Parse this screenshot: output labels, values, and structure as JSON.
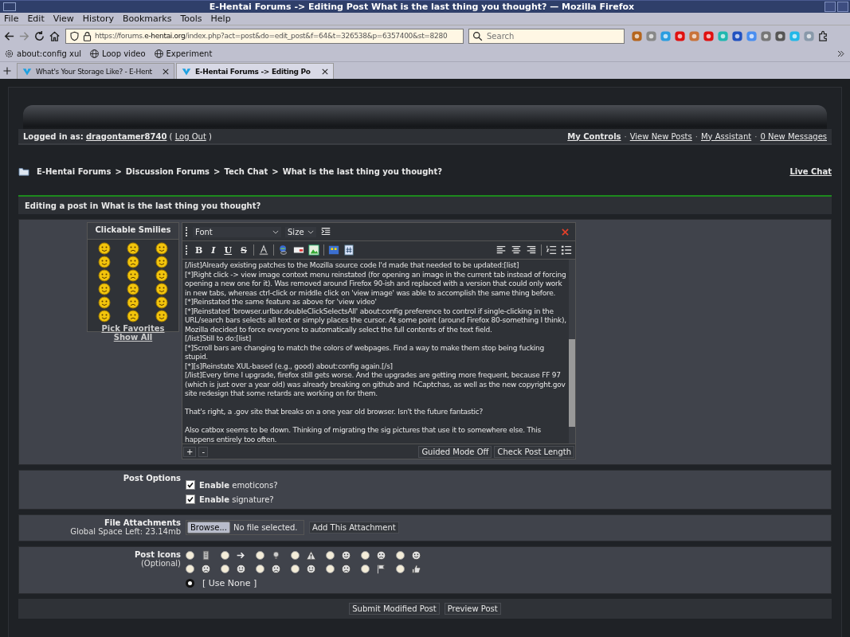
{
  "window": {
    "title": "E-Hentai Forums -> Editing Post What is the last thing you thought? — Mozilla Firefox"
  },
  "menu": [
    "File",
    "Edit",
    "View",
    "History",
    "Bookmarks",
    "Tools",
    "Help"
  ],
  "toolbar": {
    "url_prefix": "https://forums.",
    "url_host": "e-hentai.org",
    "url_path": "/index.php?act=post&do=edit_post&f=64&t=326538&p=6357400&st=8280",
    "search": {
      "placeholder": "Search"
    }
  },
  "bookmarks": [
    {
      "label": "about:config xul",
      "kind": "gear"
    },
    {
      "label": "Loop video",
      "kind": "globe"
    },
    {
      "label": "Experiment",
      "kind": "globe"
    }
  ],
  "tabs": [
    {
      "label": "What's Your Storage Like? - E-Hent",
      "selected": false
    },
    {
      "label": "E-Hentai Forums -> Editing Po",
      "selected": true
    }
  ],
  "user_bar": {
    "prefix": "Logged in as:",
    "username": "dragontamer8740",
    "logout_open": "(",
    "logout": "Log Out",
    "logout_close": ")",
    "links": [
      "My Controls",
      "View New Posts",
      "My Assistant",
      "0 New Messages"
    ],
    "separator": "·"
  },
  "breadcrumb": {
    "items": [
      "E-Hentai Forums",
      "Discussion Forums",
      "Tech Chat",
      "What is the last thing you thought?"
    ],
    "separator": ">",
    "live_chat": "Live Chat"
  },
  "editing_title": "Editing a post in What is the last thing you thought?",
  "smilies": {
    "title": "Clickable Smilies",
    "links": [
      "Pick Favorites",
      "Show All"
    ]
  },
  "editor": {
    "font": "Font",
    "size": "Size",
    "format_buttons": [
      "B",
      "I",
      "U",
      "S"
    ],
    "text": "[/list]Already existing patches to the Mozilla source code I'd made that needed to be updated:[list]\n[*]Right click -> view image context menu reinstated (for opening an image in the current tab instead of forcing opening a new one for it). Was removed around Firefox 90-ish and replaced with a version that could only work in new tabs, whereas ctrl-click or middle click on 'view image' was able to accomplish the same thing before.\n[*]Reinstated the same feature as above for 'view video'\n[*]Reinstated 'browser.urlbar.doubleClickSelectsAll' about:config preference to control if single-clicking in the URL/search bars selects all text or simply places the cursor. At some point (around Firefox 80-something I think), Mozilla decided to force everyone to automatically select the full contents of the text field.\n[/list]Still to do:[list]\n[*]Scroll bars are changing to match the colors of webpages. Find a way to make them stop being fucking stupid.\n[*][s]Reinstate XUL-based (e.g., good) about:config again.[/s]\n[/list]Every time I upgrade, firefox still gets worse. And the upgrades are getting more frequent, because FF 97 (which is just over a year old) was already breaking on github and  hCaptchas, as well as the new copyright.gov site redesign that some retards are working on for them.\n\nThat's right, a .gov site that breaks on a one year old browser. Isn't the future fantastic?\n\nAlso catbox seems to be down. Thinking of migrating the sig pictures that use it to somewhere else. This happens entirely too often.",
    "size_buttons": [
      "+",
      "-"
    ],
    "buttons": [
      "Guided Mode Off",
      "Check Post Length"
    ]
  },
  "post_options": {
    "title": "Post Options",
    "options": [
      {
        "label": "**Enable** emoticons?",
        "checked": true
      },
      {
        "label": "**Enable** signature?",
        "checked": true
      }
    ]
  },
  "attachments": {
    "title": "File Attachments",
    "space": "Global Space Left: 23.14mb",
    "browse": "Browse...",
    "file_status": "No file selected.",
    "add": "Add This Attachment"
  },
  "post_icons": {
    "title": "Post Icons",
    "subtitle": "(Optional)",
    "icons": [
      {
        "selected": false
      },
      {
        "selected": false
      },
      {
        "selected": false
      },
      {
        "selected": false
      },
      {
        "selected": false
      },
      {
        "selected": false
      },
      {
        "selected": false
      },
      {
        "selected": false
      },
      {
        "selected": false
      },
      {
        "selected": false
      },
      {
        "selected": false
      },
      {
        "selected": false
      },
      {
        "selected": false
      },
      {
        "selected": false
      }
    ],
    "none": {
      "label": "[ Use None ]",
      "selected": true
    }
  },
  "actions": [
    "Submit Modified Post",
    "Preview Post"
  ]
}
